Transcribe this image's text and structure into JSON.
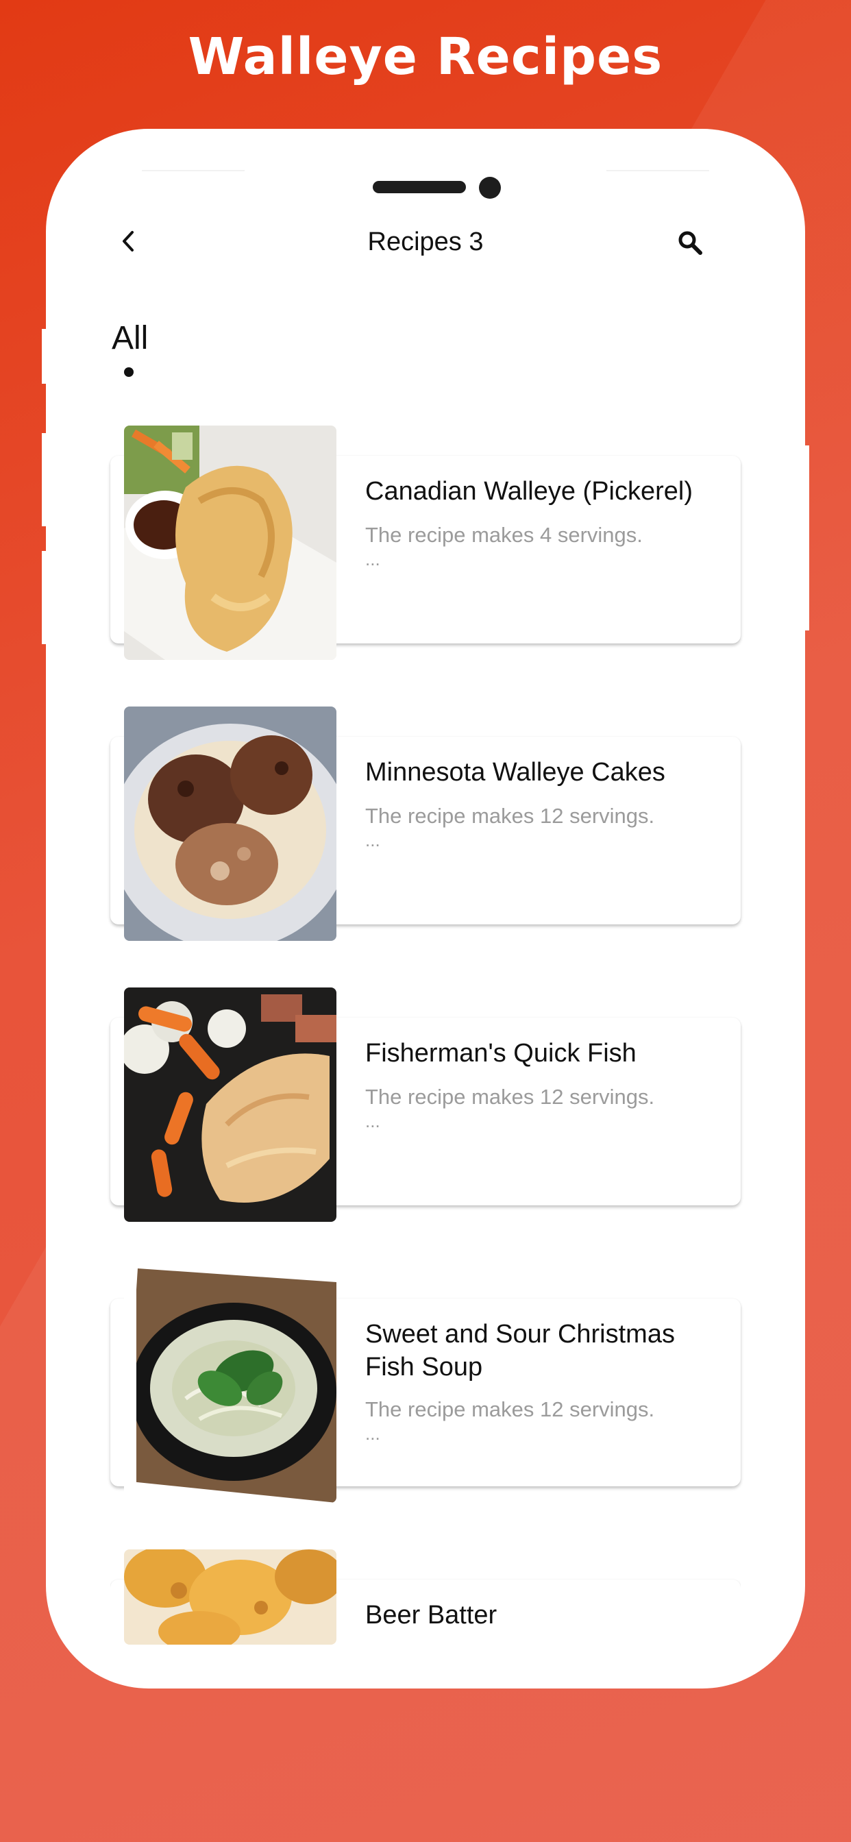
{
  "promo": {
    "title": "Walleye Recipes",
    "colors": {
      "background": "#e84a30",
      "accent": "#e23a14"
    }
  },
  "app_bar": {
    "back_icon": "chevron-left-icon",
    "title": "Recipes 3",
    "search_icon": "search-icon"
  },
  "tabs": [
    {
      "label": "All",
      "selected": true
    }
  ],
  "recipes": [
    {
      "title": "Canadian Walleye (Pickerel)",
      "description": "The recipe makes 4 servings.",
      "more": "...",
      "image": "fried-walleye-photo"
    },
    {
      "title": "Minnesota Walleye Cakes",
      "description": "The recipe makes 12 servings.",
      "more": "...",
      "image": "walleye-cakes-photo"
    },
    {
      "title": "Fisherman's Quick Fish",
      "description": "The recipe makes 12 servings.",
      "more": "...",
      "image": "baked-fish-vegetables-photo"
    },
    {
      "title": "Sweet and Sour Christmas Fish Soup",
      "description": "The recipe makes 12 servings.",
      "more": "...",
      "image": "fish-soup-bowl-photo"
    },
    {
      "title": "Beer Batter",
      "description": "",
      "more": "",
      "image": "beer-batter-fish-photo"
    }
  ]
}
